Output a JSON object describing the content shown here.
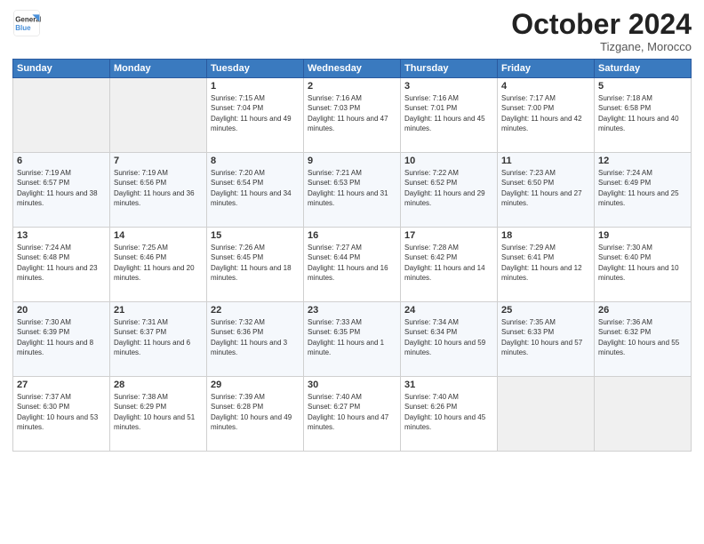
{
  "logo": {
    "line1": "General",
    "line2": "Blue"
  },
  "title": "October 2024",
  "location": "Tizgane, Morocco",
  "days_header": [
    "Sunday",
    "Monday",
    "Tuesday",
    "Wednesday",
    "Thursday",
    "Friday",
    "Saturday"
  ],
  "weeks": [
    [
      {
        "num": "",
        "text": "",
        "empty": true
      },
      {
        "num": "",
        "text": "",
        "empty": true
      },
      {
        "num": "1",
        "text": "Sunrise: 7:15 AM\nSunset: 7:04 PM\nDaylight: 11 hours and 49 minutes.",
        "empty": false
      },
      {
        "num": "2",
        "text": "Sunrise: 7:16 AM\nSunset: 7:03 PM\nDaylight: 11 hours and 47 minutes.",
        "empty": false
      },
      {
        "num": "3",
        "text": "Sunrise: 7:16 AM\nSunset: 7:01 PM\nDaylight: 11 hours and 45 minutes.",
        "empty": false
      },
      {
        "num": "4",
        "text": "Sunrise: 7:17 AM\nSunset: 7:00 PM\nDaylight: 11 hours and 42 minutes.",
        "empty": false
      },
      {
        "num": "5",
        "text": "Sunrise: 7:18 AM\nSunset: 6:58 PM\nDaylight: 11 hours and 40 minutes.",
        "empty": false
      }
    ],
    [
      {
        "num": "6",
        "text": "Sunrise: 7:19 AM\nSunset: 6:57 PM\nDaylight: 11 hours and 38 minutes.",
        "empty": false
      },
      {
        "num": "7",
        "text": "Sunrise: 7:19 AM\nSunset: 6:56 PM\nDaylight: 11 hours and 36 minutes.",
        "empty": false
      },
      {
        "num": "8",
        "text": "Sunrise: 7:20 AM\nSunset: 6:54 PM\nDaylight: 11 hours and 34 minutes.",
        "empty": false
      },
      {
        "num": "9",
        "text": "Sunrise: 7:21 AM\nSunset: 6:53 PM\nDaylight: 11 hours and 31 minutes.",
        "empty": false
      },
      {
        "num": "10",
        "text": "Sunrise: 7:22 AM\nSunset: 6:52 PM\nDaylight: 11 hours and 29 minutes.",
        "empty": false
      },
      {
        "num": "11",
        "text": "Sunrise: 7:23 AM\nSunset: 6:50 PM\nDaylight: 11 hours and 27 minutes.",
        "empty": false
      },
      {
        "num": "12",
        "text": "Sunrise: 7:24 AM\nSunset: 6:49 PM\nDaylight: 11 hours and 25 minutes.",
        "empty": false
      }
    ],
    [
      {
        "num": "13",
        "text": "Sunrise: 7:24 AM\nSunset: 6:48 PM\nDaylight: 11 hours and 23 minutes.",
        "empty": false
      },
      {
        "num": "14",
        "text": "Sunrise: 7:25 AM\nSunset: 6:46 PM\nDaylight: 11 hours and 20 minutes.",
        "empty": false
      },
      {
        "num": "15",
        "text": "Sunrise: 7:26 AM\nSunset: 6:45 PM\nDaylight: 11 hours and 18 minutes.",
        "empty": false
      },
      {
        "num": "16",
        "text": "Sunrise: 7:27 AM\nSunset: 6:44 PM\nDaylight: 11 hours and 16 minutes.",
        "empty": false
      },
      {
        "num": "17",
        "text": "Sunrise: 7:28 AM\nSunset: 6:42 PM\nDaylight: 11 hours and 14 minutes.",
        "empty": false
      },
      {
        "num": "18",
        "text": "Sunrise: 7:29 AM\nSunset: 6:41 PM\nDaylight: 11 hours and 12 minutes.",
        "empty": false
      },
      {
        "num": "19",
        "text": "Sunrise: 7:30 AM\nSunset: 6:40 PM\nDaylight: 11 hours and 10 minutes.",
        "empty": false
      }
    ],
    [
      {
        "num": "20",
        "text": "Sunrise: 7:30 AM\nSunset: 6:39 PM\nDaylight: 11 hours and 8 minutes.",
        "empty": false
      },
      {
        "num": "21",
        "text": "Sunrise: 7:31 AM\nSunset: 6:37 PM\nDaylight: 11 hours and 6 minutes.",
        "empty": false
      },
      {
        "num": "22",
        "text": "Sunrise: 7:32 AM\nSunset: 6:36 PM\nDaylight: 11 hours and 3 minutes.",
        "empty": false
      },
      {
        "num": "23",
        "text": "Sunrise: 7:33 AM\nSunset: 6:35 PM\nDaylight: 11 hours and 1 minute.",
        "empty": false
      },
      {
        "num": "24",
        "text": "Sunrise: 7:34 AM\nSunset: 6:34 PM\nDaylight: 10 hours and 59 minutes.",
        "empty": false
      },
      {
        "num": "25",
        "text": "Sunrise: 7:35 AM\nSunset: 6:33 PM\nDaylight: 10 hours and 57 minutes.",
        "empty": false
      },
      {
        "num": "26",
        "text": "Sunrise: 7:36 AM\nSunset: 6:32 PM\nDaylight: 10 hours and 55 minutes.",
        "empty": false
      }
    ],
    [
      {
        "num": "27",
        "text": "Sunrise: 7:37 AM\nSunset: 6:30 PM\nDaylight: 10 hours and 53 minutes.",
        "empty": false
      },
      {
        "num": "28",
        "text": "Sunrise: 7:38 AM\nSunset: 6:29 PM\nDaylight: 10 hours and 51 minutes.",
        "empty": false
      },
      {
        "num": "29",
        "text": "Sunrise: 7:39 AM\nSunset: 6:28 PM\nDaylight: 10 hours and 49 minutes.",
        "empty": false
      },
      {
        "num": "30",
        "text": "Sunrise: 7:40 AM\nSunset: 6:27 PM\nDaylight: 10 hours and 47 minutes.",
        "empty": false
      },
      {
        "num": "31",
        "text": "Sunrise: 7:40 AM\nSunset: 6:26 PM\nDaylight: 10 hours and 45 minutes.",
        "empty": false
      },
      {
        "num": "",
        "text": "",
        "empty": true
      },
      {
        "num": "",
        "text": "",
        "empty": true
      }
    ]
  ]
}
